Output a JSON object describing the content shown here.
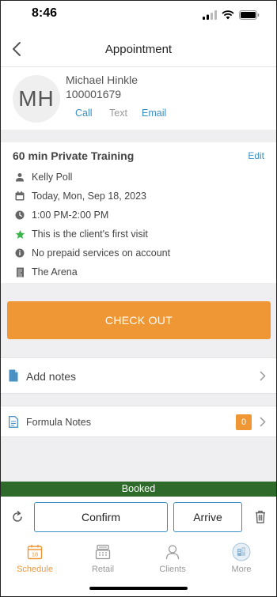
{
  "status": {
    "time": "8:46"
  },
  "nav": {
    "title": "Appointment"
  },
  "client": {
    "initials": "MH",
    "name": "Michael Hinkle",
    "id": "100001679",
    "call": "Call",
    "text": "Text",
    "email": "Email"
  },
  "appointment": {
    "service": "60 min Private Training",
    "edit": "Edit",
    "staff": "Kelly Poll",
    "date": "Today, Mon, Sep 18, 2023",
    "time": "1:00 PM-2:00 PM",
    "first_visit": "This is the client's first visit",
    "prepaid": "No prepaid services on account",
    "location": "The Arena"
  },
  "checkout": "CHECK OUT",
  "notes": {
    "label": "Add notes"
  },
  "formula": {
    "label": "Formula Notes",
    "count": "0"
  },
  "booked": "Booked",
  "actions": {
    "confirm": "Confirm",
    "arrive": "Arrive"
  },
  "tabs": {
    "schedule": "Schedule",
    "retail": "Retail",
    "clients": "Clients",
    "more": "More",
    "calendar_day": "18"
  },
  "colors": {
    "accent": "#ef9734",
    "link": "#3a8fc4",
    "booked": "#2e6b2b",
    "first_visit_star": "#3bb54a"
  }
}
